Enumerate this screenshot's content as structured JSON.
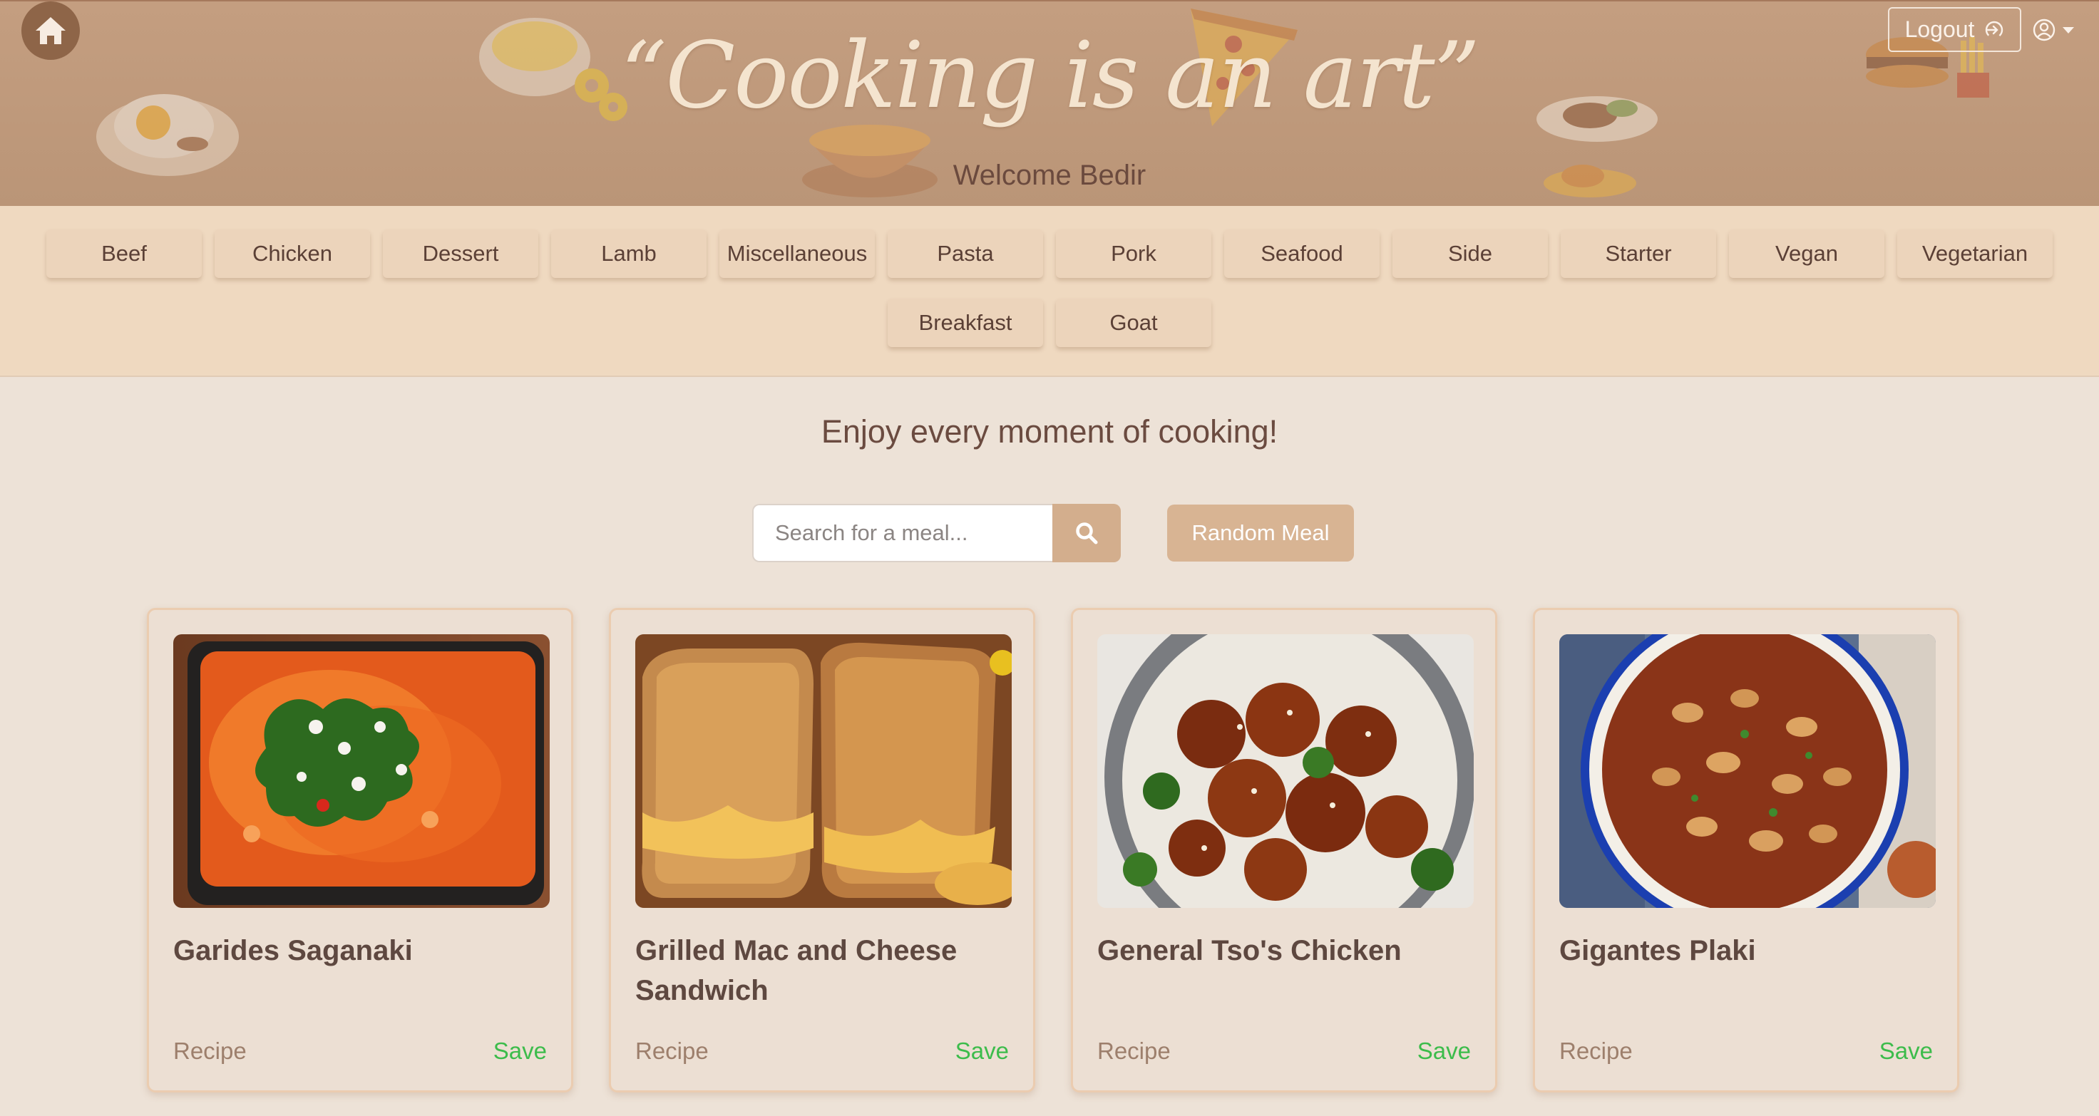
{
  "header": {
    "slogan": "“Cooking is an art”",
    "welcome": "Welcome Bedir",
    "logout_label": "Logout"
  },
  "icons": {
    "home": "home-icon",
    "logout": "logout-icon",
    "user": "user-circle-icon",
    "caret": "caret-down-icon",
    "search": "search-icon"
  },
  "categories": {
    "row1": [
      "Beef",
      "Chicken",
      "Dessert",
      "Lamb",
      "Miscellaneous",
      "Pasta",
      "Pork",
      "Seafood",
      "Side",
      "Starter",
      "Vegan",
      "Vegetarian"
    ],
    "row2": [
      "Breakfast",
      "Goat"
    ]
  },
  "main": {
    "tagline": "Enjoy every moment of cooking!",
    "search_placeholder": "Search for a meal...",
    "random_label": "Random Meal"
  },
  "cards": [
    {
      "title": "Garides Saganaki",
      "recipe_label": "Recipe",
      "save_label": "Save"
    },
    {
      "title": "Grilled Mac and Cheese Sandwich",
      "recipe_label": "Recipe",
      "save_label": "Save"
    },
    {
      "title": "General Tso's Chicken",
      "recipe_label": "Recipe",
      "save_label": "Save"
    },
    {
      "title": "Gigantes Plaki",
      "recipe_label": "Recipe",
      "save_label": "Save"
    }
  ],
  "colors": {
    "header_bg": "#c09a7c",
    "category_bar_bg": "#efd9c0",
    "page_bg": "#ede2d7",
    "accent": "#d3ae8d",
    "save_green": "#3cbc4b"
  }
}
